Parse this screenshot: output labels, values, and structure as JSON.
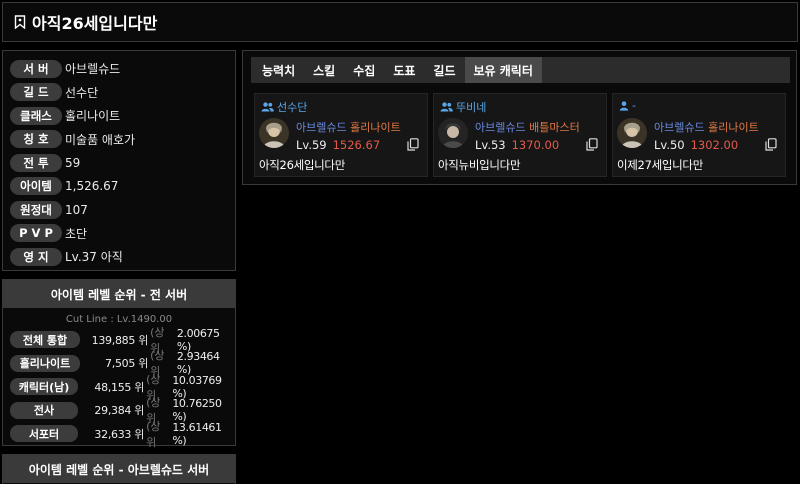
{
  "header": {
    "title": "아직26세입니다만"
  },
  "info": [
    {
      "label": "서 버",
      "value": "아브렐슈드"
    },
    {
      "label": "길 드",
      "value": "선수단"
    },
    {
      "label": "클래스",
      "value": "홀리나이트"
    },
    {
      "label": "칭 호",
      "value": "미술품 애호가"
    },
    {
      "label": "전 투",
      "value": "59"
    },
    {
      "label": "아이템",
      "value": "1,526.67"
    },
    {
      "label": "원정대",
      "value": "107"
    },
    {
      "label": "P V P",
      "value": "초단"
    },
    {
      "label": "영 지",
      "value": "Lv.37 아직"
    }
  ],
  "rank_all": {
    "title": "아이템 레벨 순위 - 전 서버",
    "cutline": "Cut Line : Lv.1490.00",
    "rows": [
      {
        "label": "전체 통합",
        "rank": "139,885 위",
        "pct_label": "(상위",
        "pct": "2.00675 %)"
      },
      {
        "label": "홀리나이트",
        "rank": "7,505 위",
        "pct_label": "(상위",
        "pct": "2.93464 %)"
      },
      {
        "label": "캐릭터(남)",
        "rank": "48,155 위",
        "pct_label": "(상위",
        "pct": "10.03769 %)"
      },
      {
        "label": "전사",
        "rank": "29,384 위",
        "pct_label": "(상위",
        "pct": "10.76250 %)"
      },
      {
        "label": "서포터",
        "rank": "32,633 위",
        "pct_label": "(상위",
        "pct": "13.61461 %)"
      }
    ]
  },
  "rank_server": {
    "title": "아이템 레벨 순위 - 아브렐슈드 서버"
  },
  "tabs": [
    "능력치",
    "스킬",
    "수집",
    "도표",
    "길드",
    "보유 캐릭터"
  ],
  "active_tab": 5,
  "characters": [
    {
      "guild": "선수단",
      "guild_icon": "users-icon",
      "server": "아브렐슈드",
      "class": "홀리나이트",
      "level": "Lv.59",
      "item_level": "1526.67",
      "name": "아직26세입니다만",
      "portrait": "holy-knight"
    },
    {
      "guild": "뚜비네",
      "guild_icon": "users-icon",
      "server": "아브렐슈드",
      "class": "배틀마스터",
      "level": "Lv.53",
      "item_level": "1370.00",
      "name": "아직뉴비입니다만",
      "portrait": "battle-master"
    },
    {
      "guild": "-",
      "guild_icon": "user-icon",
      "server": "아브렐슈드",
      "class": "홀리나이트",
      "level": "Lv.50",
      "item_level": "1302.00",
      "name": "이제27세입니다만",
      "portrait": "holy-knight"
    }
  ],
  "colors": {
    "guild": "#5aa6e8",
    "server": "#6a8ae0",
    "class": "#e07a46",
    "item_level": "#e35a4a"
  }
}
